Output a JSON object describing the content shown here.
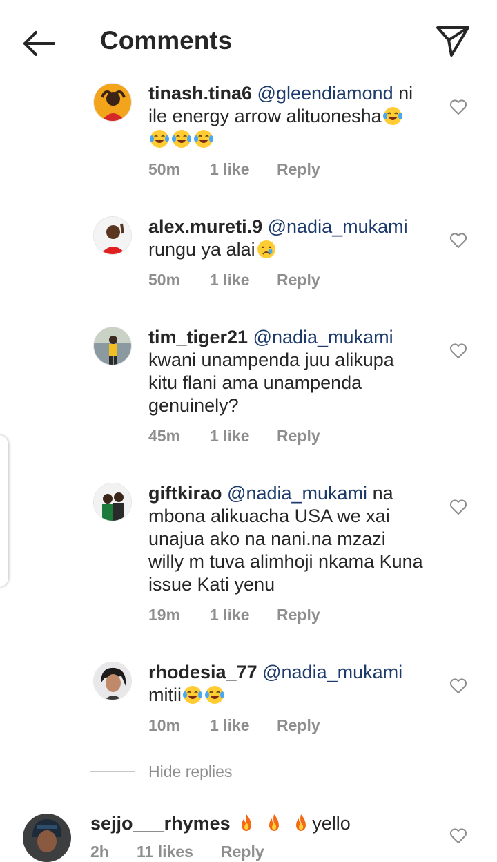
{
  "header": {
    "title": "Comments",
    "back_icon": "arrow-left-icon",
    "share_icon": "send-icon"
  },
  "comments": [
    {
      "username": "tinash.tina6",
      "mention": "@gleendiamond",
      "text": "ni ile energy arrow alituonesha",
      "emojis": [
        "laughing-tears",
        "laughing-tears",
        "laughing-tears",
        "laughing-tears"
      ],
      "time": "50m",
      "likes": "1 like",
      "reply": "Reply"
    },
    {
      "username": "alex.mureti.9",
      "mention": "@nadia_mukami",
      "text": "rungu ya alai",
      "emojis": [
        "crying-face"
      ],
      "time": "50m",
      "likes": "1 like",
      "reply": "Reply"
    },
    {
      "username": "tim_tiger21",
      "mention": "@nadia_mukami",
      "text": "kwani unampenda juu alikupa kitu flani ama unampenda genuinely?",
      "emojis": [],
      "time": "45m",
      "likes": "1 like",
      "reply": "Reply"
    },
    {
      "username": "giftkirao",
      "mention": "@nadia_mukami",
      "text": "na mbona alikuacha USA we xai unajua ako na nani.na mzazi willy m tuva alimhoji nkama Kuna issue Kati yenu",
      "emojis": [],
      "time": "19m",
      "likes": "1 like",
      "reply": "Reply"
    },
    {
      "username": "rhodesia_77",
      "mention": "@nadia_mukami",
      "text": "mitii",
      "emojis": [
        "laughing-tears",
        "laughing-tears"
      ],
      "time": "10m",
      "likes": "1 like",
      "reply": "Reply"
    }
  ],
  "hide_replies": "Hide replies",
  "parent_comment": {
    "username": "sejjo___rhymes",
    "text": "yello",
    "emojis": [
      "fire",
      "fire",
      "fire"
    ],
    "time": "2h",
    "likes": "11 likes",
    "reply": "Reply"
  },
  "colors": {
    "mention": "#1c3a6b",
    "meta": "#8e8e8e",
    "text": "#262626"
  }
}
